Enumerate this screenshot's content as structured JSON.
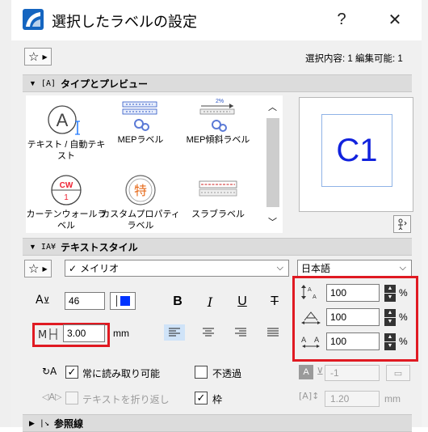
{
  "window": {
    "title": "選択したラベルの設定",
    "help_label": "?",
    "close_label": "✕"
  },
  "header": {
    "selection_info": "選択内容: 1 編集可能: 1"
  },
  "sections": {
    "type_preview": "タイプとプレビュー",
    "text_style": "テキストスタイル",
    "reference_line": "参照線"
  },
  "library": {
    "items": [
      {
        "label": "テキスト / 自動テキスト",
        "icon": "auto-text-icon"
      },
      {
        "label": "MEPラベル",
        "icon": "mep-label-icon"
      },
      {
        "label": "MEP傾斜ラベル",
        "icon": "mep-slope-label-icon"
      },
      {
        "label": "カーテンウォールラベル",
        "icon": "curtain-wall-label-icon"
      },
      {
        "label": "カスタムプロパティラベル",
        "icon": "custom-property-label-icon"
      },
      {
        "label": "スラブラベル",
        "icon": "slab-label-icon"
      }
    ],
    "icon_texts": {
      "cw": "CW",
      "cw_num": "1",
      "custom": "特"
    }
  },
  "preview": {
    "text": "C1"
  },
  "text_style": {
    "font": "メイリオ",
    "font_check": "✓",
    "language": "日本語",
    "font_size": "46",
    "frame_width": "3.00",
    "unit_mm": "mm",
    "bold": "B",
    "italic": "I",
    "underline": "U",
    "strike": "T",
    "line_spacing": "100",
    "width_factor": "100",
    "char_spacing": "100",
    "percent": "%",
    "always_readable": "常に読み取り可能",
    "opaque": "不透過",
    "wrap_text": "テキストを折り返し",
    "frame": "枠",
    "pen_value": "-1",
    "offset_value": "1.20",
    "offset_unit": "mm",
    "check_mark": "✓"
  },
  "colors": {
    "accent_red": "#e01a22",
    "pen_blue": "#0033ff",
    "preview_blue": "#1122dd",
    "selected_align": "#cfe3f8"
  }
}
